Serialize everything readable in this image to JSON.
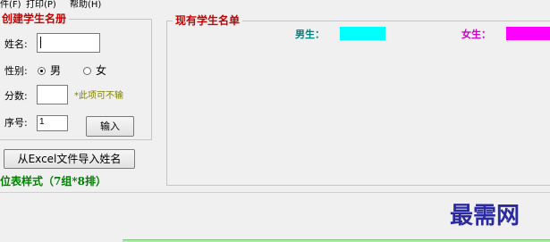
{
  "menu": {
    "items": [
      {
        "label": "件(F)"
      },
      {
        "label": "打印(P)"
      },
      {
        "label": "帮助(H)"
      }
    ]
  },
  "create_group": {
    "title": "创建学生名册",
    "name_label": "姓名:",
    "name_value": "",
    "gender_label": "性别:",
    "gender_options": [
      "男",
      "女"
    ],
    "gender_selected": "男",
    "score_label": "分数:",
    "score_value": "",
    "score_note": "*此项可不输",
    "seq_label": "序号:",
    "seq_value": "1",
    "input_button": "输入"
  },
  "import_button": "从Excel文件导入姓名",
  "layout_caption": "位表样式（7组*8排）",
  "roster_group": {
    "title": "现有学生名单",
    "boys_label": "男生：",
    "girls_label": "女生：",
    "boys_color": "#00ffff",
    "girls_color": "#ff00ff"
  },
  "watermark": "最需网",
  "colors": {
    "title_red": "#cc0000",
    "caption_green": "#008000",
    "note_olive": "#808000",
    "boys_text": "#008080",
    "girls_text": "#cc00cc",
    "watermark_blue": "#2b2b9f"
  }
}
